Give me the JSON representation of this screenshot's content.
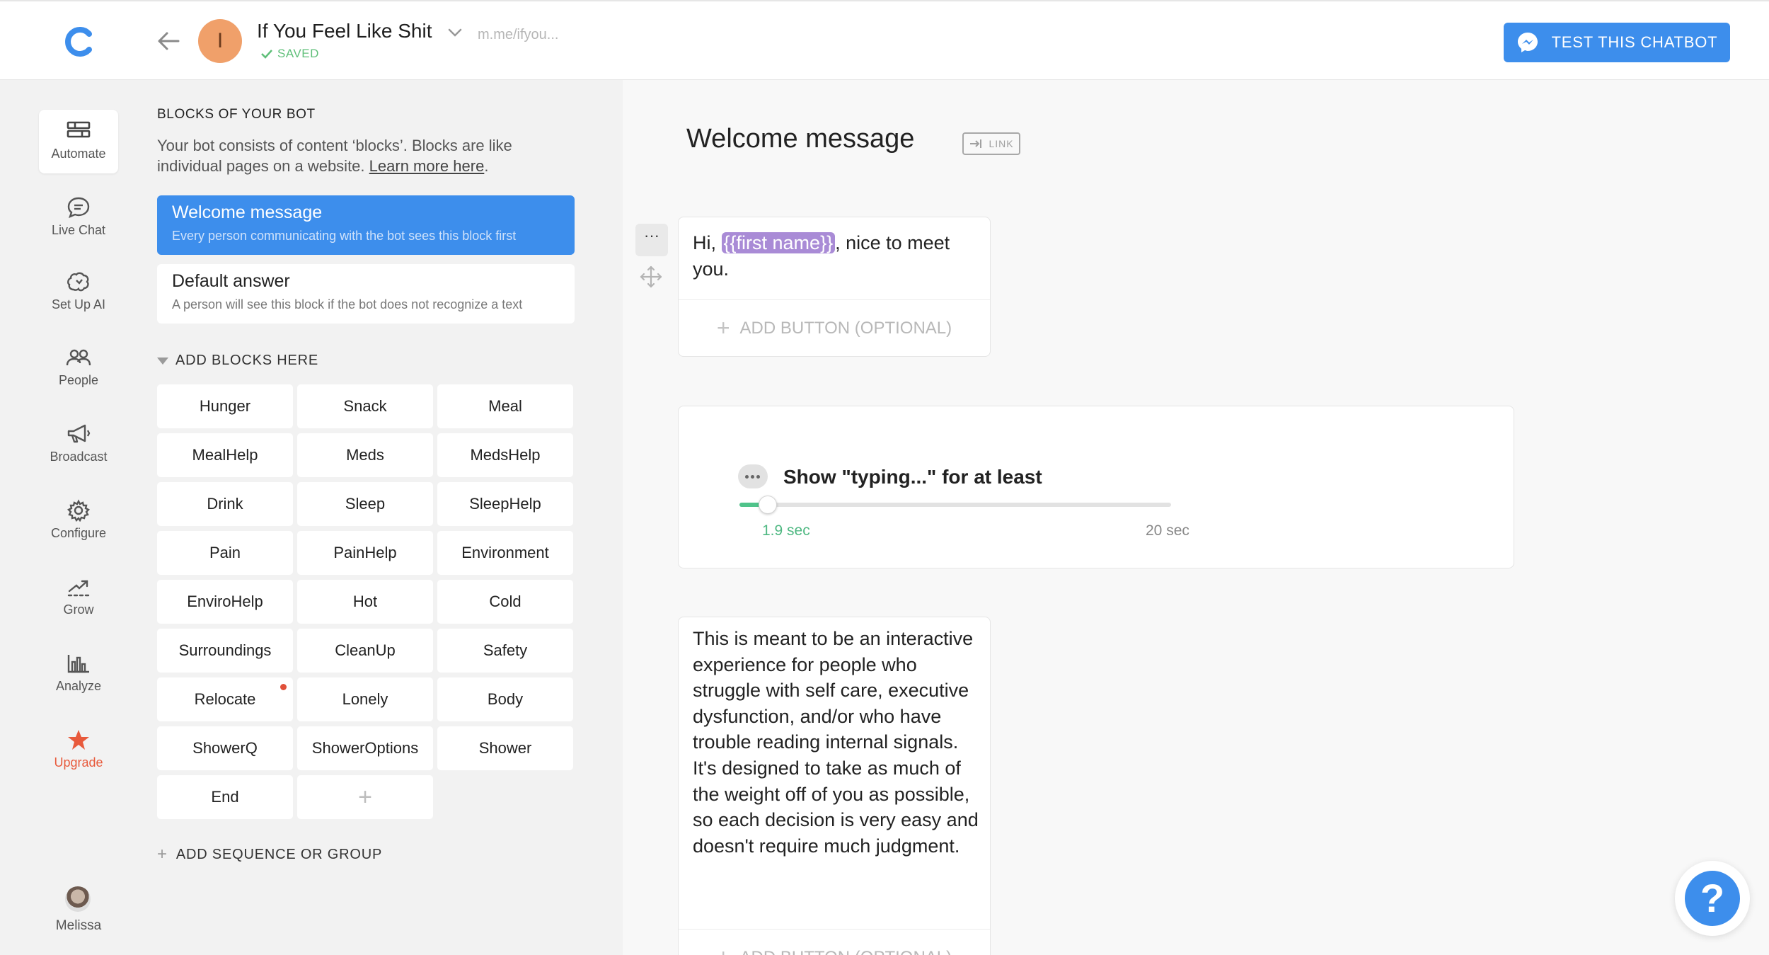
{
  "header": {
    "bot_initial": "I",
    "bot_name": "If You Feel Like Shit",
    "bot_url": "m.me/ifyou...",
    "saved_label": "SAVED",
    "test_button": "TEST THIS CHATBOT"
  },
  "nav": {
    "items": [
      {
        "label": "Automate",
        "icon": "blocks-icon"
      },
      {
        "label": "Live Chat",
        "icon": "chat-bubble-icon"
      },
      {
        "label": "Set Up AI",
        "icon": "brain-icon"
      },
      {
        "label": "People",
        "icon": "people-icon"
      },
      {
        "label": "Broadcast",
        "icon": "megaphone-icon"
      },
      {
        "label": "Configure",
        "icon": "gear-icon"
      },
      {
        "label": "Grow",
        "icon": "growth-arrow-icon"
      },
      {
        "label": "Analyze",
        "icon": "bar-chart-icon"
      },
      {
        "label": "Upgrade",
        "icon": "star-icon"
      }
    ],
    "user_name": "Melissa"
  },
  "panel": {
    "title": "BLOCKS OF YOUR BOT",
    "description": "Your bot consists of content ‘blocks’. Blocks are like individual pages on a website. ",
    "learn_more": "Learn more here",
    "welcome_block": {
      "title": "Welcome message",
      "desc": "Every person communicating with the bot sees this block first"
    },
    "default_block": {
      "title": "Default answer",
      "desc": "A person will see this block if the bot does not recognize a text"
    },
    "add_blocks_label": "ADD BLOCKS HERE",
    "blocks": [
      "Hunger",
      "Snack",
      "Meal",
      "MealHelp",
      "Meds",
      "MedsHelp",
      "Drink",
      "Sleep",
      "SleepHelp",
      "Pain",
      "PainHelp",
      "Environment",
      "EnviroHelp",
      "Hot",
      "Cold",
      "Surroundings",
      "CleanUp",
      "Safety",
      "Relocate",
      "Lonely",
      "Body",
      "ShowerQ",
      "ShowerOptions",
      "Shower",
      "End"
    ],
    "add_block_plus": "+",
    "add_sequence_label": "ADD SEQUENCE OR GROUP"
  },
  "main": {
    "title": "Welcome message",
    "link_label": "LINK",
    "tool_dots": "···",
    "card1": {
      "prefix": "Hi, ",
      "tag": "{{first name}}",
      "suffix": ", nice to meet you."
    },
    "add_button_label": "ADD BUTTON (OPTIONAL)",
    "typing": {
      "label": "Show \"typing...\" for at least",
      "min_label": "1.9 sec",
      "max_label": "20 sec",
      "value": 1.9,
      "max": 20
    },
    "card3_text": "This is meant to be an interactive experience for people who struggle with self care, executive dysfunction, and/or who have trouble reading internal signals. It's designed to take as much of the weight off of you as possible, so each decision is very easy and doesn't require much judgment.",
    "help_label": "?"
  },
  "colors": {
    "accent": "#3d8eec",
    "tag": "#a98bd6",
    "upgrade": "#e85a3c",
    "slider": "#4fc38a",
    "saved": "#5fbf79"
  }
}
